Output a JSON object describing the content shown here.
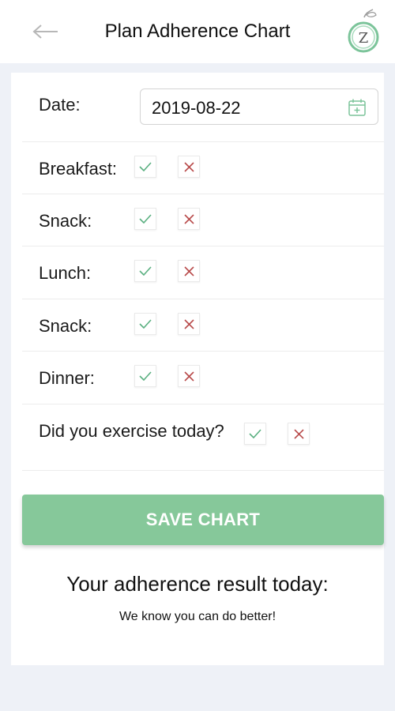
{
  "header": {
    "title": "Plan Adherence Chart",
    "back_icon": "arrow-left-icon",
    "logo_letter": "Z",
    "logo_color": "#7cc49a"
  },
  "form": {
    "date_label": "Date:",
    "date_value": "2019-08-22",
    "date_icon": "calendar-icon",
    "meals": [
      {
        "label": "Breakfast:"
      },
      {
        "label": "Snack:"
      },
      {
        "label": "Lunch:"
      },
      {
        "label": "Snack:"
      },
      {
        "label": "Dinner:"
      }
    ],
    "exercise_label": "Did you exercise today?",
    "check_color": "#5bb081",
    "cross_color": "#b84b4b"
  },
  "save_button": {
    "label": "SAVE CHART",
    "color": "#86c89a"
  },
  "result": {
    "title": "Your adherence result today:",
    "message": "We know you can do better!"
  }
}
